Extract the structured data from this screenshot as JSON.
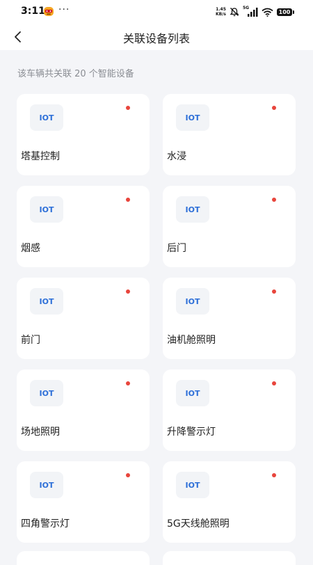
{
  "status_bar": {
    "time": "3:11",
    "dots": "···",
    "net_speed_value": "1.45",
    "net_speed_unit": "KB/s",
    "network": "5G",
    "battery": "100"
  },
  "header": {
    "title": "关联设备列表"
  },
  "summary": "该车辆共关联 20 个智能设备",
  "colors": {
    "accent": "#2d6fd8",
    "status_dot": "#e8453c",
    "background": "#f4f5f8"
  },
  "devices": [
    {
      "badge": "IOT",
      "name": "塔基控制"
    },
    {
      "badge": "IOT",
      "name": "水浸"
    },
    {
      "badge": "IOT",
      "name": "烟感"
    },
    {
      "badge": "IOT",
      "name": "后门"
    },
    {
      "badge": "IOT",
      "name": "前门"
    },
    {
      "badge": "IOT",
      "name": "油机舱照明"
    },
    {
      "badge": "IOT",
      "name": "场地照明"
    },
    {
      "badge": "IOT",
      "name": "升降警示灯"
    },
    {
      "badge": "IOT",
      "name": "四角警示灯"
    },
    {
      "badge": "IOT",
      "name": "5G天线舱照明"
    }
  ]
}
